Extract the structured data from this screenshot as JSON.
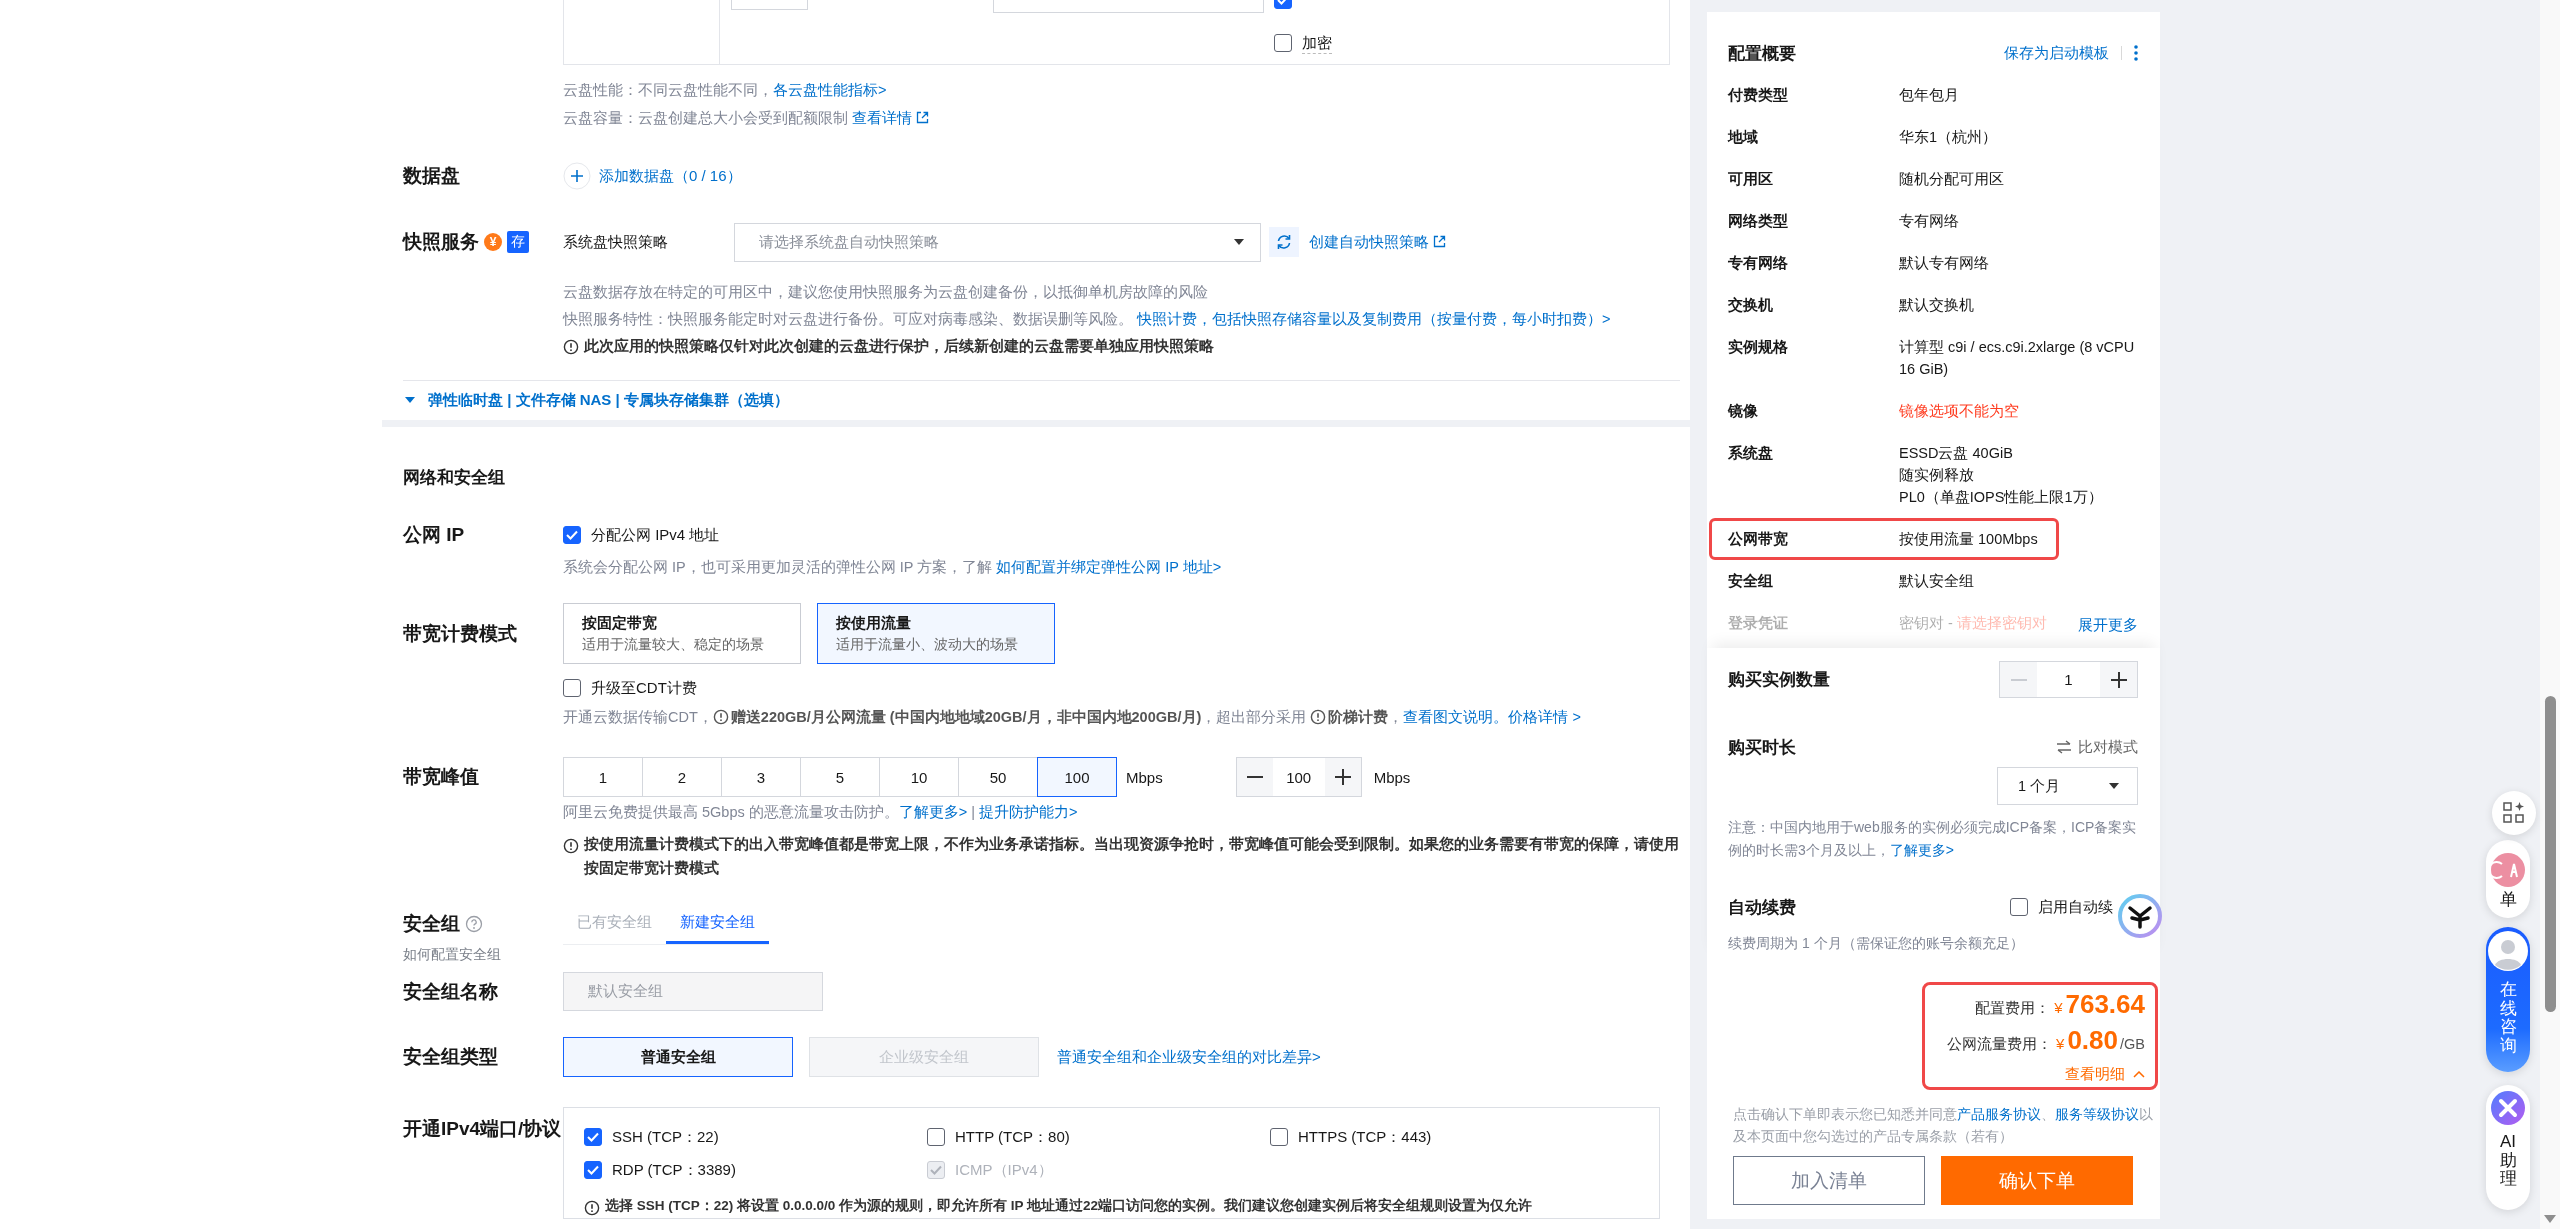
{
  "disk_table": {
    "checkboxes": [
      {
        "checked": true
      },
      {
        "label": "加密",
        "checked": false
      }
    ]
  },
  "disk_notes": [
    {
      "text": "云盘性能：不同云盘性能不同，",
      "link": "各云盘性能指标>",
      "external": false
    },
    {
      "text": "云盘容量：云盘创建总大小会受到配额限制 ",
      "link": "查看详情",
      "external": true
    }
  ],
  "data_disk": {
    "label": "数据盘",
    "add_link": "添加数据盘（0 / 16）"
  },
  "snapshot": {
    "label": "快照服务",
    "fee_icon": "¥",
    "badge": "存",
    "field_label": "系统盘快照策略",
    "placeholder": "请选择系统盘自动快照策略",
    "create_link": "创建自动快照策略",
    "notes": [
      {
        "text": "云盘数据存放在特定的可用区中，建议您使用快照服务为云盘创建备份，以抵御单机房故障的风险"
      },
      {
        "text": "快照服务特性：快照服务能定时对云盘进行备份。可应对病毒感染、数据误删等风险。 ",
        "link": "快照计费，包括快照存储容量以及复制费用（按量付费，每小时扣费）>"
      }
    ],
    "warning": "此次应用的快照策略仅针对此次创建的云盘进行保护，后续新创建的云盘需要单独应用快照策略"
  },
  "more_options": "弹性临时盘 | 文件存储 NAS | 专属块存储集群（选填）",
  "network": {
    "title": "网络和安全组",
    "public_ip": {
      "label": "公网 IP",
      "option": {
        "label": "分配公网 IPv4 地址",
        "checked": true
      },
      "note": "系统会分配公网 IP，也可采用更加灵活的弹性公网 IP 方案，了解 ",
      "note_link": "如何配置并绑定弹性公网 IP 地址>"
    },
    "billing": {
      "label": "带宽计费模式",
      "options": [
        {
          "title": "按固定带宽",
          "desc": "适用于流量较大、稳定的场景",
          "selected": false
        },
        {
          "title": "按使用流量",
          "desc": "适用于流量小、波动大的场景",
          "selected": true
        }
      ],
      "cdt": {
        "label": "升级至CDT计费",
        "checked": false
      },
      "note": [
        {
          "kind": "text",
          "text": "开通云数据传输CDT，"
        },
        {
          "kind": "info",
          "text": "赠送220GB/月公网流量 (中国内地地域20GB/月，非中国内地200GB/月)"
        },
        {
          "kind": "text",
          "text": "，超出部分采用 "
        },
        {
          "kind": "info",
          "text": "阶梯计费"
        },
        {
          "kind": "text",
          "text": "，"
        },
        {
          "kind": "link",
          "text": "查看图文说明。价格详情 >"
        }
      ]
    },
    "bandwidth": {
      "label": "带宽峰值",
      "presets": [
        {
          "value": "1",
          "selected": false
        },
        {
          "value": "2",
          "selected": false
        },
        {
          "value": "3",
          "selected": false
        },
        {
          "value": "5",
          "selected": false
        },
        {
          "value": "10",
          "selected": false
        },
        {
          "value": "50",
          "selected": false
        },
        {
          "value": "100",
          "selected": true
        }
      ],
      "unit": "Mbps",
      "custom": {
        "value": "100",
        "unit": "Mbps"
      },
      "note": "阿里云免费提供最高 5Gbps 的恶意流量攻击防护。",
      "links": [
        "了解更多>",
        "提升防护能力>"
      ],
      "separator": "|",
      "warning": "按使用流量计费模式下的出入带宽峰值都是带宽上限，不作为业务承诺指标。当出现资源争抢时，带宽峰值可能会受到限制。如果您的业务需要有带宽的保障，请使用按固定带宽计费模式"
    },
    "security_group": {
      "label": "安全组",
      "help_link": "如何配置安全组",
      "tabs": [
        {
          "label": "已有安全组",
          "selected": false
        },
        {
          "label": "新建安全组",
          "selected": true
        }
      ]
    },
    "group_name": {
      "label": "安全组名称",
      "value": "默认安全组",
      "disabled": true
    },
    "group_type": {
      "label": "安全组类型",
      "options": [
        {
          "label": "普通安全组",
          "selected": true,
          "disabled": false
        },
        {
          "label": "企业级安全组",
          "selected": false,
          "disabled": true
        }
      ],
      "link": "普通安全组和企业级安全组的对比差异>"
    },
    "ports": {
      "label": "开通IPv4端口/协议",
      "options": [
        {
          "label": "SSH (TCP：22)",
          "checked": true,
          "disabled": false
        },
        {
          "label": "HTTP (TCP：80)",
          "checked": false,
          "disabled": false
        },
        {
          "label": "HTTPS (TCP：443)",
          "checked": false,
          "disabled": false
        },
        {
          "label": "RDP (TCP：3389)",
          "checked": true,
          "disabled": false
        },
        {
          "label": "ICMP（IPv4）",
          "checked": true,
          "disabled": true
        }
      ],
      "warning": "选择 SSH (TCP：22) 将设置 0.0.0.0/0 作为源的规则，即允许所有 IP 地址通过22端口访问您的实例。我们建议您创建实例后将安全组规则设置为仅允许"
    }
  },
  "summary": {
    "title": "配置概要",
    "save_link": "保存为启动模板",
    "rows": [
      {
        "label": "付费类型",
        "lines": [
          "包年包月"
        ],
        "highlighted": false,
        "faded": false
      },
      {
        "label": "地域",
        "lines": [
          "华东1（杭州）"
        ],
        "highlighted": false,
        "faded": false
      },
      {
        "label": "可用区",
        "lines": [
          "随机分配可用区"
        ],
        "highlighted": false,
        "faded": false
      },
      {
        "label": "网络类型",
        "lines": [
          "专有网络"
        ],
        "highlighted": false,
        "faded": false
      },
      {
        "label": "专有网络",
        "lines": [
          "默认专有网络"
        ],
        "highlighted": false,
        "faded": false
      },
      {
        "label": "交换机",
        "lines": [
          "默认交换机"
        ],
        "highlighted": false,
        "faded": false
      },
      {
        "label": "实例规格",
        "lines": [
          "计算型 c9i / ecs.c9i.2xlarge (8 vCPU",
          "16 GiB)"
        ],
        "highlighted": false,
        "faded": false
      },
      {
        "label": "镜像",
        "alert": "镜像选项不能为空",
        "highlighted": false,
        "faded": false
      },
      {
        "label": "系统盘",
        "lines": [
          "ESSD云盘 40GiB",
          "随实例释放",
          "PL0（单盘IOPS性能上限1万）"
        ],
        "highlighted": false,
        "faded": false
      },
      {
        "label": "公网带宽",
        "lines": [
          "按使用流量 100Mbps"
        ],
        "highlighted": true,
        "faded": false
      },
      {
        "label": "安全组",
        "lines": [
          "默认安全组"
        ],
        "highlighted": false,
        "faded": false
      },
      {
        "label": "登录凭证",
        "lines": [
          "密钥对 - "
        ],
        "alert": "请选择密钥对",
        "highlighted": false,
        "faded": true
      }
    ],
    "expand_link": "展开更多"
  },
  "purchase": {
    "quantity": {
      "label": "购买实例数量",
      "value": "1",
      "minus_disabled": true
    },
    "duration": {
      "label": "购买时长",
      "compare": "比对模式",
      "value": "1 个月",
      "note": "注意：中国内地用于web服务的实例必须完成ICP备案，ICP备案实例的时长需3个月及以上，",
      "note_link": "了解更多>"
    },
    "auto_renew": {
      "label": "自动续费",
      "option": {
        "label": "启用自动续",
        "checked": false
      },
      "note": "续费周期为 1 个月（需保证您的账号余额充足）"
    }
  },
  "price": {
    "highlighted": true,
    "items": [
      {
        "label": "配置费用：",
        "currency": "¥",
        "amount": "763.64"
      },
      {
        "label": "公网流量费用：",
        "currency": "¥",
        "amount": "0.80",
        "unit": "/GB"
      }
    ],
    "detail_link": "查看明细"
  },
  "agreement": [
    {
      "kind": "text",
      "text": "点击确认下单即表示您已知悉并同意"
    },
    {
      "kind": "link",
      "text": "产品服务协议"
    },
    {
      "kind": "text",
      "text": "、"
    },
    {
      "kind": "link",
      "text": "服务等级协议"
    },
    {
      "kind": "text",
      "text": "以及本页面中您勾选过的产品专属条款（若有）"
    }
  ],
  "buttons": [
    {
      "label": "加入清单",
      "kind": "secondary"
    },
    {
      "label": "确认下单",
      "kind": "primary"
    }
  ],
  "float_bar": [
    {
      "kind": "cart",
      "label": "单"
    },
    {
      "kind": "consult",
      "label": "在线咨询"
    },
    {
      "kind": "ai",
      "label": "AI助理"
    }
  ]
}
